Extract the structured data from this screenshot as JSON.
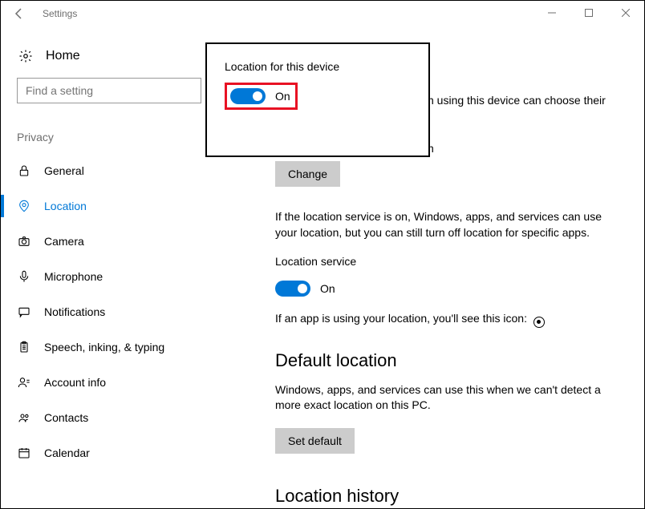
{
  "window": {
    "title": "Settings"
  },
  "home": {
    "label": "Home"
  },
  "search": {
    "placeholder": "Find a setting"
  },
  "group": {
    "label": "Privacy"
  },
  "nav": {
    "general": {
      "label": "General"
    },
    "location": {
      "label": "Location"
    },
    "camera": {
      "label": "Camera"
    },
    "microphone": {
      "label": "Microphone"
    },
    "notifications": {
      "label": "Notifications"
    },
    "speech": {
      "label": "Speech, inking, & typing"
    },
    "account": {
      "label": "Account info"
    },
    "contacts": {
      "label": "Contacts"
    },
    "calendar": {
      "label": "Calendar"
    }
  },
  "callout": {
    "title": "Location for this device",
    "toggle_state": "On"
  },
  "main": {
    "partial1": "n using this device can choose their",
    "partial2": "n",
    "change_btn": "Change",
    "paragraph": "If the location service is on, Windows, apps, and services can use your location, but you can still turn off location for specific apps.",
    "loc_service_label": "Location service",
    "loc_service_state": "On",
    "app_icon_line": "If an app is using your location, you'll see this icon:",
    "default_heading": "Default location",
    "default_paragraph": "Windows, apps, and services can use this when we can't detect a more exact location on this PC.",
    "set_default_btn": "Set default",
    "history_heading": "Location history"
  }
}
